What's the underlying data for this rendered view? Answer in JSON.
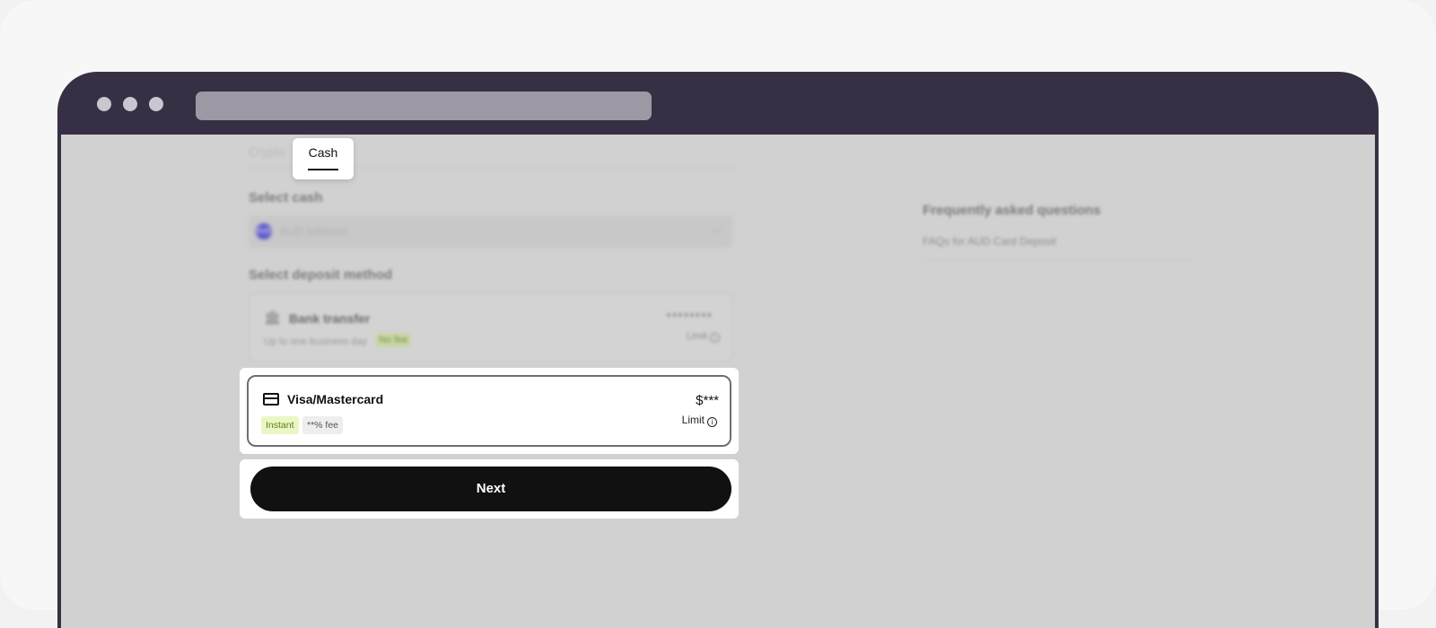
{
  "tabs": {
    "crypto": "Crypto",
    "cash": "Cash"
  },
  "select_cash": {
    "label": "Select cash",
    "avatar": "AUD",
    "value": "AUD balance"
  },
  "deposit": {
    "label": "Select deposit method",
    "bank": {
      "icon": "bank-icon",
      "title": "Bank transfer",
      "description": "Up to one business day",
      "fee": "No fee",
      "value": "********",
      "limit": "Limit"
    },
    "card": {
      "icon": "credit-card-icon",
      "title": "Visa/Mastercard",
      "badge_instant": "Instant",
      "badge_fee": "**% fee",
      "value": "$***",
      "limit": "Limit"
    }
  },
  "next_label": "Next",
  "faq": {
    "title": "Frequently asked questions",
    "link": "FAQs for AUD Card Deposit"
  },
  "colors": {
    "browser_frame": "#373044",
    "primary_button": "#111111",
    "instant_badge_bg": "#eaf7c4"
  }
}
